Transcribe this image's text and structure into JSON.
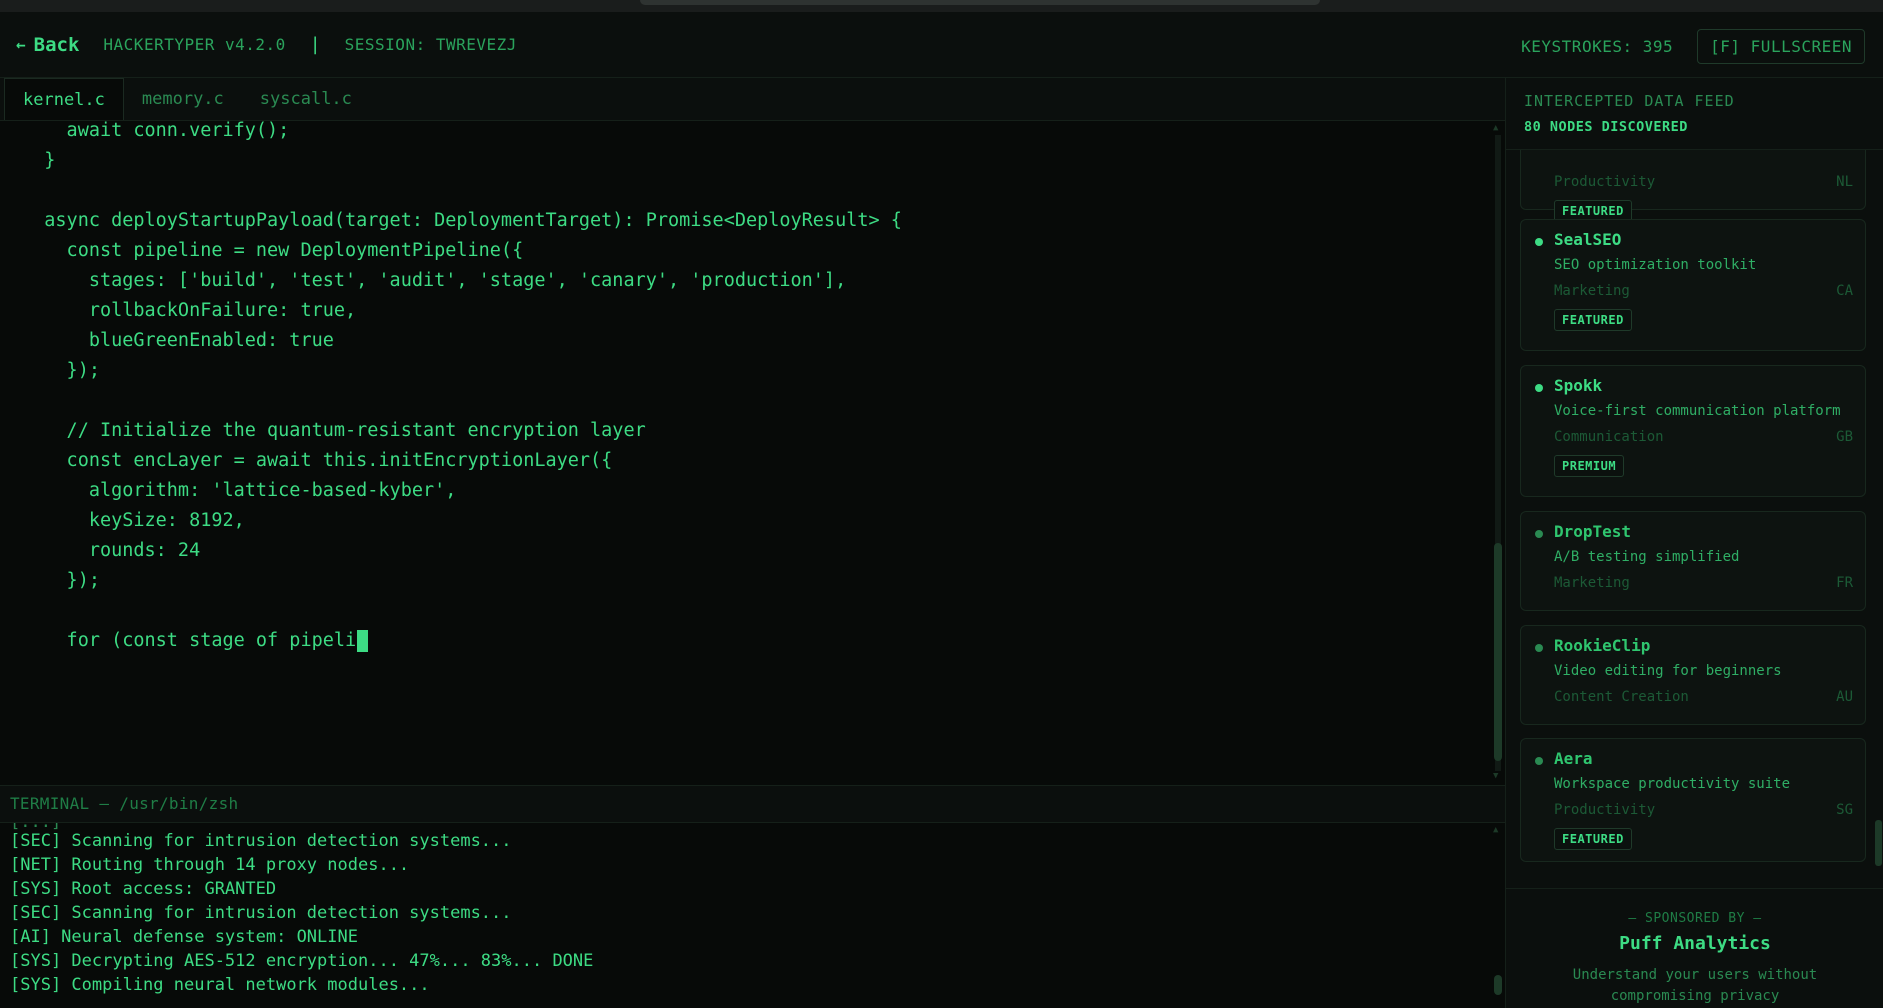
{
  "header": {
    "back_label": "Back",
    "app_name": "HACKERTYPER v4.2.0",
    "separator": "|",
    "session": "SESSION: TWREVEZJ",
    "keystrokes": "KEYSTROKES: 395",
    "fullscreen_label": "[F] FULLSCREEN"
  },
  "tabs": [
    {
      "label": "kernel.c",
      "active": true
    },
    {
      "label": "memory.c",
      "active": false
    },
    {
      "label": "syscall.c",
      "active": false
    }
  ],
  "editor": {
    "lines": [
      "    await conn.verify();",
      "  }",
      "",
      "  async deployStartupPayload(target: DeploymentTarget): Promise<DeployResult> {",
      "    const pipeline = new DeploymentPipeline({",
      "      stages: ['build', 'test', 'audit', 'stage', 'canary', 'production'],",
      "      rollbackOnFailure: true,",
      "      blueGreenEnabled: true",
      "    });",
      "",
      "    // Initialize the quantum-resistant encryption layer",
      "    const encLayer = await this.initEncryptionLayer({",
      "      algorithm: 'lattice-based-kyber',",
      "      keySize: 8192,",
      "      rounds: 24",
      "    });",
      "",
      "    for (const stage of pipeli"
    ]
  },
  "terminal": {
    "title": "TERMINAL — /usr/bin/zsh",
    "lines": [
      "[SEC] Scanning for intrusion detection systems...",
      "[NET] Routing through 14 proxy nodes...",
      "[SYS] Root access: GRANTED",
      "[SEC] Scanning for intrusion detection systems...",
      "[AI] Neural defense system: ONLINE",
      "[SYS] Decrypting AES-512 encryption... 47%... 83%... DONE",
      "[SYS] Compiling neural network modules..."
    ]
  },
  "feed": {
    "title": "INTERCEPTED DATA FEED",
    "count": "80 NODES DISCOVERED",
    "partial_card": {
      "category": "Productivity",
      "country": "NL",
      "badge": "FEATURED"
    },
    "cards": [
      {
        "name": "SealSEO",
        "description": "SEO optimization toolkit",
        "category": "Marketing",
        "country": "CA",
        "badge": "FEATURED"
      },
      {
        "name": "Spokk",
        "description": "Voice-first communication platform",
        "category": "Communication",
        "country": "GB",
        "badge": "PREMIUM"
      },
      {
        "name": "DropTest",
        "description": "A/B testing simplified",
        "category": "Marketing",
        "country": "FR",
        "badge": ""
      },
      {
        "name": "RookieClip",
        "description": "Video editing for beginners",
        "category": "Content Creation",
        "country": "AU",
        "badge": ""
      },
      {
        "name": "Aera",
        "description": "Workspace productivity suite",
        "category": "Productivity",
        "country": "SG",
        "badge": "FEATURED"
      }
    ]
  },
  "sponsor": {
    "label": "— SPONSORED BY —",
    "name": "Puff Analytics",
    "tagline": "Understand your users without compromising privacy"
  },
  "colors": {
    "accent": "#3ddc84",
    "background": "#070a08",
    "panel": "#0b0f0d",
    "muted": "#2a8a52"
  }
}
